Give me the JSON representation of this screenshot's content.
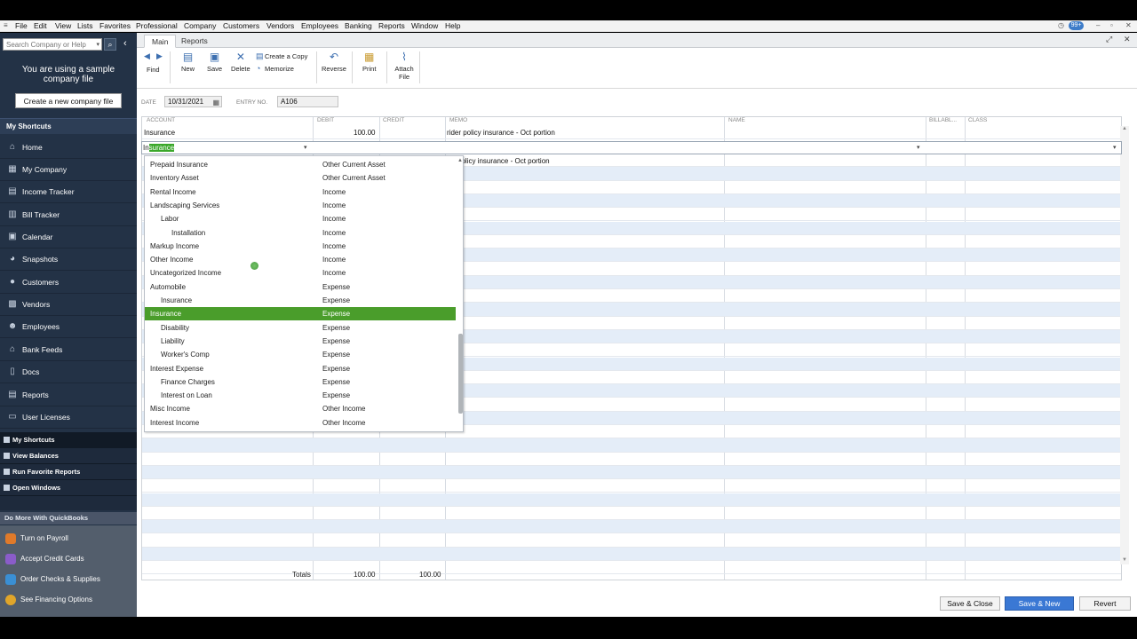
{
  "menubar": {
    "items": [
      "File",
      "Edit",
      "View",
      "Lists",
      "Favorites",
      "Professional",
      "Company",
      "Customers",
      "Vendors",
      "Employees",
      "Banking",
      "Reports",
      "Window",
      "Help"
    ],
    "badge": "99+",
    "controls": [
      "–",
      "▫",
      "✕"
    ]
  },
  "sidebar": {
    "search_placeholder": "Search Company or Help",
    "sample_text": "You are using a sample company file",
    "create_button": "Create a new company file",
    "section_header": "My Shortcuts",
    "shortcuts": [
      "Home",
      "My Company",
      "Income Tracker",
      "Bill Tracker",
      "Calendar",
      "Snapshots",
      "Customers",
      "Vendors",
      "Employees",
      "Bank Feeds",
      "Docs",
      "Reports",
      "User Licenses"
    ],
    "tabs": [
      "My Shortcuts",
      "View Balances",
      "Run Favorite Reports",
      "Open Windows"
    ],
    "do_more_header": "Do More With QuickBooks",
    "do_more": [
      {
        "label": "Turn on Payroll",
        "color": "#e07a2a"
      },
      {
        "label": "Accept Credit Cards",
        "color": "#8a5cc9"
      },
      {
        "label": "Order Checks & Supplies",
        "color": "#3a8fd4"
      },
      {
        "label": "See Financing Options",
        "color": "#e0a52a"
      }
    ]
  },
  "window": {
    "tabs": [
      "Main",
      "Reports"
    ],
    "toolbar": {
      "find": "Find",
      "new": "New",
      "save": "Save",
      "delete": "Delete",
      "create_copy": "Create a Copy",
      "memorize": "Memorize",
      "reverse": "Reverse",
      "print": "Print",
      "attach": "Attach File"
    }
  },
  "entry": {
    "date_label": "DATE",
    "date": "10/31/2021",
    "entry_no_label": "ENTRY NO.",
    "entry_no": "A106"
  },
  "grid": {
    "columns": [
      "ACCOUNT",
      "DEBIT",
      "CREDIT",
      "MEMO",
      "NAME",
      "BILLABL...",
      "CLASS"
    ],
    "row1": {
      "account": "Insurance",
      "debit": "100.00",
      "memo": "rider policy insurance - Oct portion"
    },
    "active_account_prefix": "In",
    "active_account_selected": "surance",
    "behind_memo": "policy insurance - Oct portion",
    "totals_label": "Totals",
    "total_debit": "100.00",
    "total_credit": "100.00"
  },
  "dropdown": [
    {
      "name": "Prepaid Insurance",
      "type": "Other Current Asset",
      "indent": 0
    },
    {
      "name": "Inventory Asset",
      "type": "Other Current Asset",
      "indent": 0
    },
    {
      "name": "Rental Income",
      "type": "Income",
      "indent": 0
    },
    {
      "name": "Landscaping Services",
      "type": "Income",
      "indent": 0
    },
    {
      "name": "Labor",
      "type": "Income",
      "indent": 1
    },
    {
      "name": "Installation",
      "type": "Income",
      "indent": 2
    },
    {
      "name": "Markup Income",
      "type": "Income",
      "indent": 0
    },
    {
      "name": "Other Income",
      "type": "Income",
      "indent": 0
    },
    {
      "name": "Uncategorized Income",
      "type": "Income",
      "indent": 0
    },
    {
      "name": "Automobile",
      "type": "Expense",
      "indent": 0
    },
    {
      "name": "Insurance",
      "type": "Expense",
      "indent": 1
    },
    {
      "name": "Insurance",
      "type": "Expense",
      "indent": 0,
      "highlight": true
    },
    {
      "name": "Disability",
      "type": "Expense",
      "indent": 1
    },
    {
      "name": "Liability",
      "type": "Expense",
      "indent": 1
    },
    {
      "name": "Worker's Comp",
      "type": "Expense",
      "indent": 1
    },
    {
      "name": "Interest Expense",
      "type": "Expense",
      "indent": 0
    },
    {
      "name": "Finance Charges",
      "type": "Expense",
      "indent": 1
    },
    {
      "name": "Interest on Loan",
      "type": "Expense",
      "indent": 1
    },
    {
      "name": "Misc Income",
      "type": "Other Income",
      "indent": 0
    },
    {
      "name": "Interest Income",
      "type": "Other Income",
      "indent": 0
    }
  ],
  "footer": {
    "save_close": "Save & Close",
    "save_new": "Save & New",
    "revert": "Revert"
  }
}
